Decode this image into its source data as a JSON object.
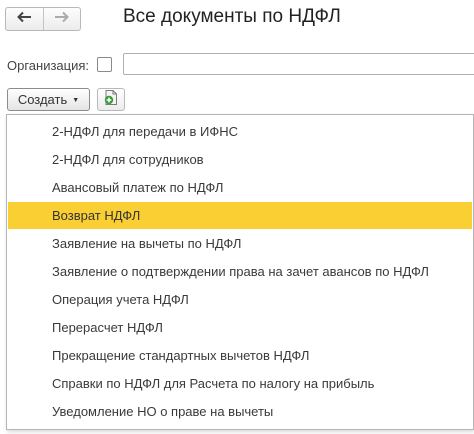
{
  "header": {
    "title": "Все документы по НДФЛ",
    "back_glyph": "🡐",
    "forward_glyph": "🡒"
  },
  "filters": {
    "organization_label": "Организация:",
    "organization_checked": false,
    "organization_value": ""
  },
  "toolbar": {
    "create_label": "Создать",
    "create_caret": "▼"
  },
  "colors": {
    "highlight": "#f9cf33",
    "icon_green": "#3a9a3a"
  },
  "dropdown": {
    "selected_index": 3,
    "items": [
      {
        "label": "2-НДФЛ для передачи в ИФНС"
      },
      {
        "label": "2-НДФЛ для сотрудников"
      },
      {
        "label": "Авансовый платеж по НДФЛ"
      },
      {
        "label": "Возврат НДФЛ"
      },
      {
        "label": "Заявление на вычеты по НДФЛ"
      },
      {
        "label": "Заявление о подтверждении права на зачет авансов по НДФЛ"
      },
      {
        "label": "Операция учета НДФЛ"
      },
      {
        "label": "Перерасчет НДФЛ"
      },
      {
        "label": "Прекращение стандартных вычетов НДФЛ"
      },
      {
        "label": "Справки по НДФЛ для Расчета по налогу на прибыль"
      },
      {
        "label": "Уведомление НО о праве на вычеты"
      }
    ]
  }
}
